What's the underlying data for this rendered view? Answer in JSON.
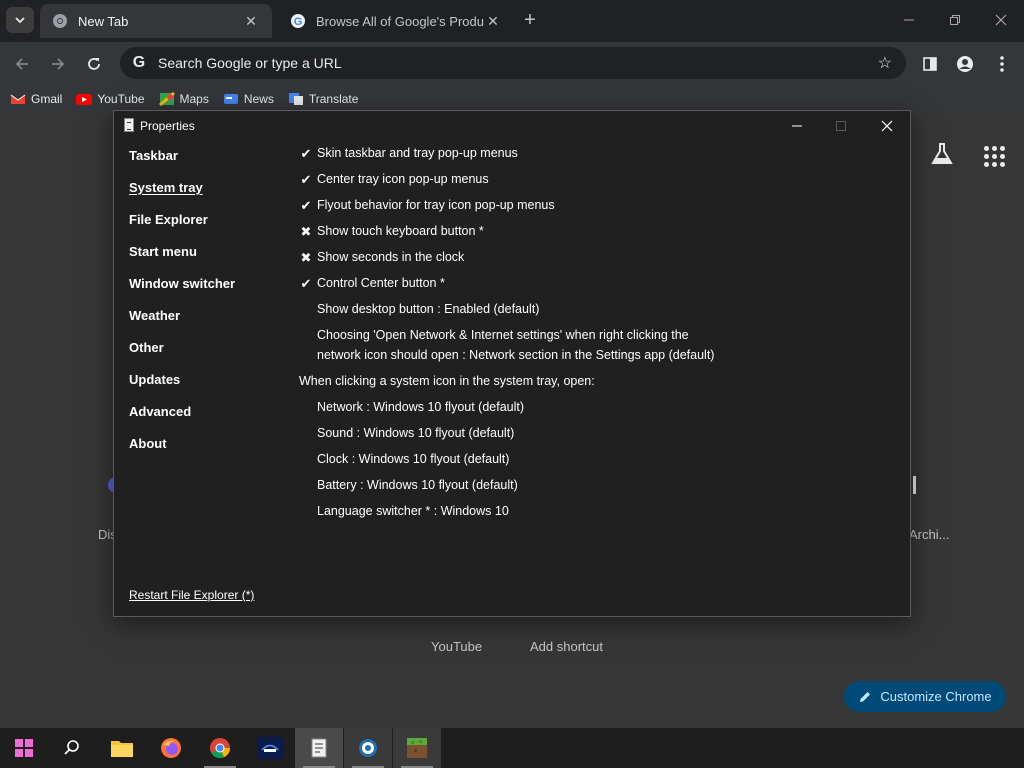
{
  "browser": {
    "tabs": [
      {
        "title": "New Tab",
        "active": true
      },
      {
        "title": "Browse All of Google's Products",
        "active": false
      }
    ],
    "omnibox": {
      "placeholder": "Search Google or type a URL"
    },
    "bookmarks": [
      {
        "label": "Gmail",
        "icon": "gmail-icon",
        "color": "#ea4335"
      },
      {
        "label": "YouTube",
        "icon": "youtube-icon",
        "color": "#ff0000"
      },
      {
        "label": "Maps",
        "icon": "maps-icon",
        "color": "#34a853"
      },
      {
        "label": "News",
        "icon": "news-icon",
        "color": "#4285f4"
      },
      {
        "label": "Translate",
        "icon": "translate-icon",
        "color": "#4285f4"
      }
    ]
  },
  "ntp": {
    "shortcuts": [
      {
        "label": "Dis"
      },
      {
        "label": "Archi..."
      },
      {
        "label": "YouTube"
      },
      {
        "label": "Add shortcut"
      }
    ],
    "customize_label": "Customize Chrome"
  },
  "dialog": {
    "title": "Properties",
    "nav": [
      {
        "label": "Taskbar",
        "selected": false
      },
      {
        "label": "System tray",
        "selected": true
      },
      {
        "label": "File Explorer",
        "selected": false
      },
      {
        "label": "Start menu",
        "selected": false
      },
      {
        "label": "Window switcher",
        "selected": false
      },
      {
        "label": "Weather",
        "selected": false
      },
      {
        "label": "Other",
        "selected": false
      },
      {
        "label": "Updates",
        "selected": false
      },
      {
        "label": "Advanced",
        "selected": false
      },
      {
        "label": "About",
        "selected": false
      }
    ],
    "options": [
      {
        "text": "Skin taskbar and tray pop-up menus",
        "state": "checked"
      },
      {
        "text": "Center tray icon pop-up menus",
        "state": "checked"
      },
      {
        "text": "Flyout behavior for tray icon pop-up menus",
        "state": "checked"
      },
      {
        "text": "Show touch keyboard button *",
        "state": "unchecked"
      },
      {
        "text": "Show seconds in the clock",
        "state": "unchecked"
      },
      {
        "text": "Control Center button *",
        "state": "checked"
      },
      {
        "text": "Show desktop button : Enabled (default)",
        "state": "none"
      },
      {
        "text": "Choosing 'Open Network & Internet settings' when right clicking the",
        "state": "none"
      },
      {
        "text": "network icon should open : Network section in the Settings app (default)",
        "state": "none"
      }
    ],
    "section_header": "When clicking a system icon in the system tray, open:",
    "sub_options": [
      {
        "text": "Network : Windows 10 flyout (default)"
      },
      {
        "text": "Sound : Windows 10 flyout (default)"
      },
      {
        "text": "Clock : Windows 10 flyout (default)"
      },
      {
        "text": "Battery : Windows 10 flyout (default)"
      },
      {
        "text": "Language switcher * : Windows 10"
      }
    ],
    "restart_link": "Restart File Explorer (*)"
  },
  "taskbar": {
    "items": [
      {
        "name": "start-button",
        "icon": "windows-icon"
      },
      {
        "name": "search-button",
        "icon": "search-icon"
      },
      {
        "name": "file-explorer",
        "icon": "folder-icon"
      },
      {
        "name": "firefox",
        "icon": "firefox-icon"
      },
      {
        "name": "chrome",
        "icon": "chrome-icon"
      },
      {
        "name": "disney-plus",
        "icon": "disney-plus-icon"
      },
      {
        "name": "properties-app",
        "icon": "properties-icon"
      },
      {
        "name": "settings",
        "icon": "settings-gear-icon"
      },
      {
        "name": "minecraft",
        "icon": "minecraft-icon"
      }
    ]
  }
}
